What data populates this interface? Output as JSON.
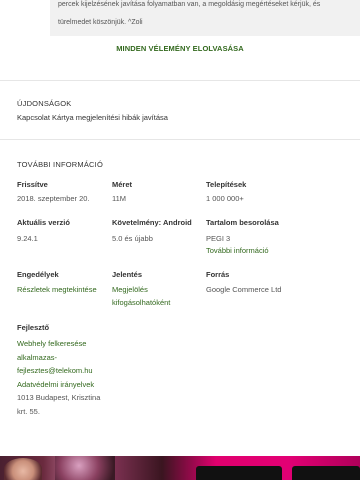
{
  "review": {
    "text_line1": "percek kijelzésének javítása folyamatban van, a megoldásig megértéseket kérjük, és",
    "text_line2": "türelmedet köszönjük. ^Zoli"
  },
  "read_all_label": "MINDEN VÉLEMÉNY ELOLVASÁSA",
  "whats_new": {
    "title": "ÚJDONSÁGOK",
    "text": "Kapcsolat Kártya megjelenítési hibák javítása"
  },
  "additional_info": {
    "title": "TOVÁBBI INFORMÁCIÓ",
    "updated": {
      "label": "Frissítve",
      "value": "2018. szeptember 20."
    },
    "size": {
      "label": "Méret",
      "value": "11M"
    },
    "installs": {
      "label": "Telepítések",
      "value": "1 000 000+"
    },
    "version": {
      "label": "Aktuális verzió",
      "value": "9.24.1"
    },
    "requires": {
      "label": "Követelmény: Android",
      "value": "5.0 és újabb"
    },
    "rating": {
      "label": "Tartalom besorolása",
      "value": "PEGI 3",
      "link": "További információ"
    },
    "permissions": {
      "label": "Engedélyek",
      "link": "Részletek megtekintése"
    },
    "report": {
      "label": "Jelentés",
      "link_line1": "Megjelölés",
      "link_line2": "kifogásolhatóként"
    },
    "offered_by": {
      "label": "Forrás",
      "value": "Google Commerce Ltd"
    },
    "developer": {
      "label": "Fejlesztő",
      "website": "Webhely felkeresése",
      "email_line1": "alkalmazas-",
      "email_line2": "fejlesztes@telekom.hu",
      "privacy": "Adatvédelmi irányelvek",
      "address_line1": "1013 Budapest, Krisztina",
      "address_line2": "krt. 55."
    }
  },
  "colors": {
    "accent_green": "#33691e",
    "review_bg": "#f1f1f1",
    "banner_magenta": "#e20074"
  }
}
